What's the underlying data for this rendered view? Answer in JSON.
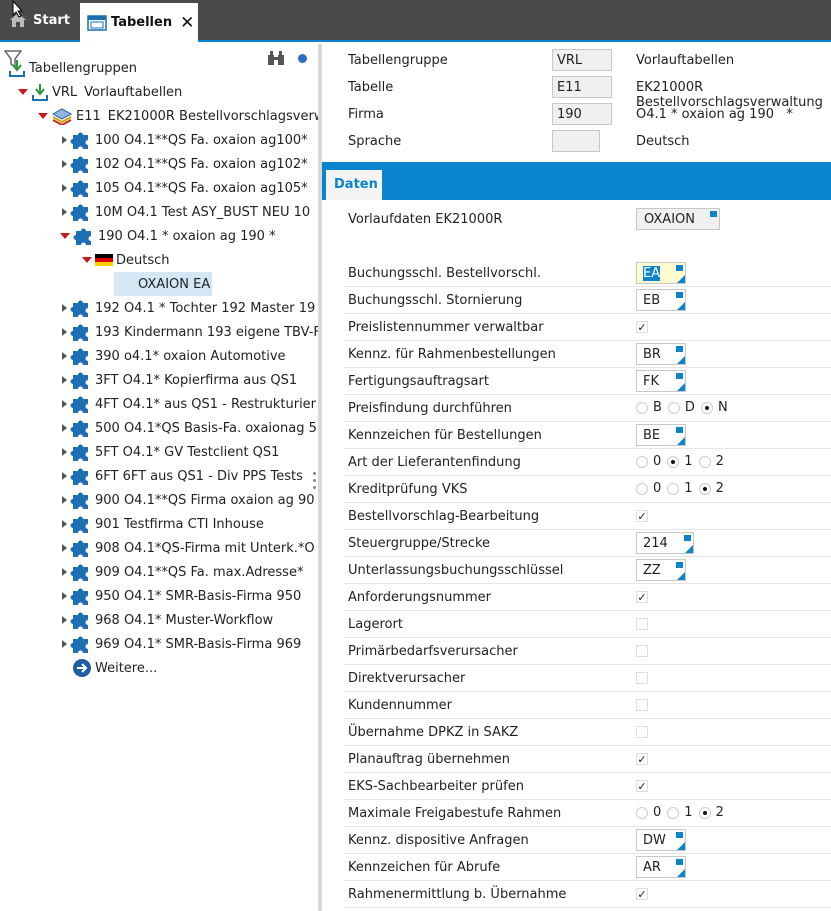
{
  "tabs": {
    "start": "Start",
    "tables": "Tabellen"
  },
  "tree": {
    "root": "Tabellengruppen",
    "group": {
      "code": "VRL",
      "name": "Vorlauftabellen"
    },
    "table": {
      "code": "E11",
      "name": "EK21000R Bestellvorschlagsverw"
    },
    "firms_before": [
      "100 O4.1**QS Fa. oxaion ag100*",
      "102 O4.1**QS Fa. oxaion ag102*",
      "105 O4.1**QS Fa. oxaion ag105*",
      "10M O4.1 Test ASY_BUST NEU    10"
    ],
    "open_firm": "190 O4.1 * oxaion ag 190   *",
    "language": "Deutsch",
    "selected_item": "OXAION  EA",
    "firms_after": [
      "192 O4.1 * Tochter 192 Master 19",
      "193 Kindermann 193 eigene TBV-F",
      "390 o4.1* oxaion Automotive",
      "3FT O4.1* Kopierfirma aus  QS1",
      "4FT O4.1* aus QS1 - Restrukturier",
      "500 O4.1*QS Basis-Fa. oxaionag 5",
      "5FT O4.1* GV Testclient QS1",
      "6FT 6FT aus QS1 - Div PPS Tests",
      "900 O4.1**QS Firma oxaion ag 90",
      "901 Testfirma CTI Inhouse",
      "908 O4.1*QS-Firma mit Unterk.*O",
      "909 O4.1**QS Fa. max.Adresse*",
      "950 O4.1* SMR-Basis-Firma 950",
      "968 O4.1* Muster-Workflow",
      "969 O4.1* SMR-Basis-Firma 969"
    ],
    "more": "Weitere..."
  },
  "header": [
    {
      "label": "Tabellengruppe",
      "value": "VRL",
      "desc": "Vorlauftabellen"
    },
    {
      "label": "Tabelle",
      "value": "E11",
      "desc": "EK21000R Bestellvorschlagsverwaltung"
    },
    {
      "label": "Firma",
      "value": "190",
      "desc": "O4.1 * oxaion ag 190   *"
    },
    {
      "label": "Sprache",
      "value": "",
      "desc": "Deutsch"
    }
  ],
  "daten_tab": "Daten",
  "vorlauf": {
    "label": "Vorlaufdaten EK21000R",
    "value": "OXAION"
  },
  "fields": [
    {
      "label": "Buchungsschl. Bestellvorschl.",
      "type": "box",
      "value": "EA",
      "highlight": true
    },
    {
      "label": "Buchungsschl. Stornierung",
      "type": "box",
      "value": "EB"
    },
    {
      "label": "Preislistennummer verwaltbar",
      "type": "check",
      "checked": true
    },
    {
      "label": "Kennz. für Rahmenbestellungen",
      "type": "box",
      "value": "BR"
    },
    {
      "label": "Fertigungsauftragsart",
      "type": "box",
      "value": "FK"
    },
    {
      "label": "Preisfindung durchführen",
      "type": "radio",
      "options": [
        "B",
        "D",
        "N"
      ],
      "selected": "N"
    },
    {
      "label": "Kennzeichen für Bestellungen",
      "type": "box",
      "value": "BE"
    },
    {
      "label": "Art der Lieferantenfindung",
      "type": "radio",
      "options": [
        "0",
        "1",
        "2"
      ],
      "selected": "1"
    },
    {
      "label": "Kreditprüfung VKS",
      "type": "radio",
      "options": [
        "0",
        "1",
        "2"
      ],
      "selected": "2"
    },
    {
      "label": "Bestellvorschlag-Bearbeitung",
      "type": "check",
      "checked": true
    },
    {
      "label": "Steuergruppe/Strecke",
      "type": "box",
      "value": "214",
      "wide": true
    },
    {
      "label": "Unterlassungsbuchungsschlüssel",
      "type": "box",
      "value": "ZZ"
    },
    {
      "label": "Anforderungsnummer",
      "type": "check",
      "checked": true
    },
    {
      "label": "Lagerort",
      "type": "check",
      "checked": false
    },
    {
      "label": "Primärbedarfsverursacher",
      "type": "check",
      "checked": false
    },
    {
      "label": "Direktverursacher",
      "type": "check",
      "checked": false
    },
    {
      "label": "Kundennummer",
      "type": "check",
      "checked": false
    },
    {
      "label": "Übernahme DPKZ in SAKZ",
      "type": "check",
      "checked": false
    },
    {
      "label": "Planauftrag übernehmen",
      "type": "check",
      "checked": true
    },
    {
      "label": "EKS-Sachbearbeiter prüfen",
      "type": "check",
      "checked": true
    },
    {
      "label": "Maximale Freigabestufe Rahmen",
      "type": "radio",
      "options": [
        "0",
        "1",
        "2"
      ],
      "selected": "2"
    },
    {
      "label": "Kennz. dispositive Anfragen",
      "type": "box",
      "value": "DW"
    },
    {
      "label": "Kennzeichen für Abrufe",
      "type": "box",
      "value": "AR"
    },
    {
      "label": "Rahmenermittlung b. Übernahme",
      "type": "check",
      "checked": true
    }
  ],
  "colors": {
    "accent": "#0a84cc",
    "tabbar": "#4a4a4a",
    "selection": "#d3e7f5"
  }
}
